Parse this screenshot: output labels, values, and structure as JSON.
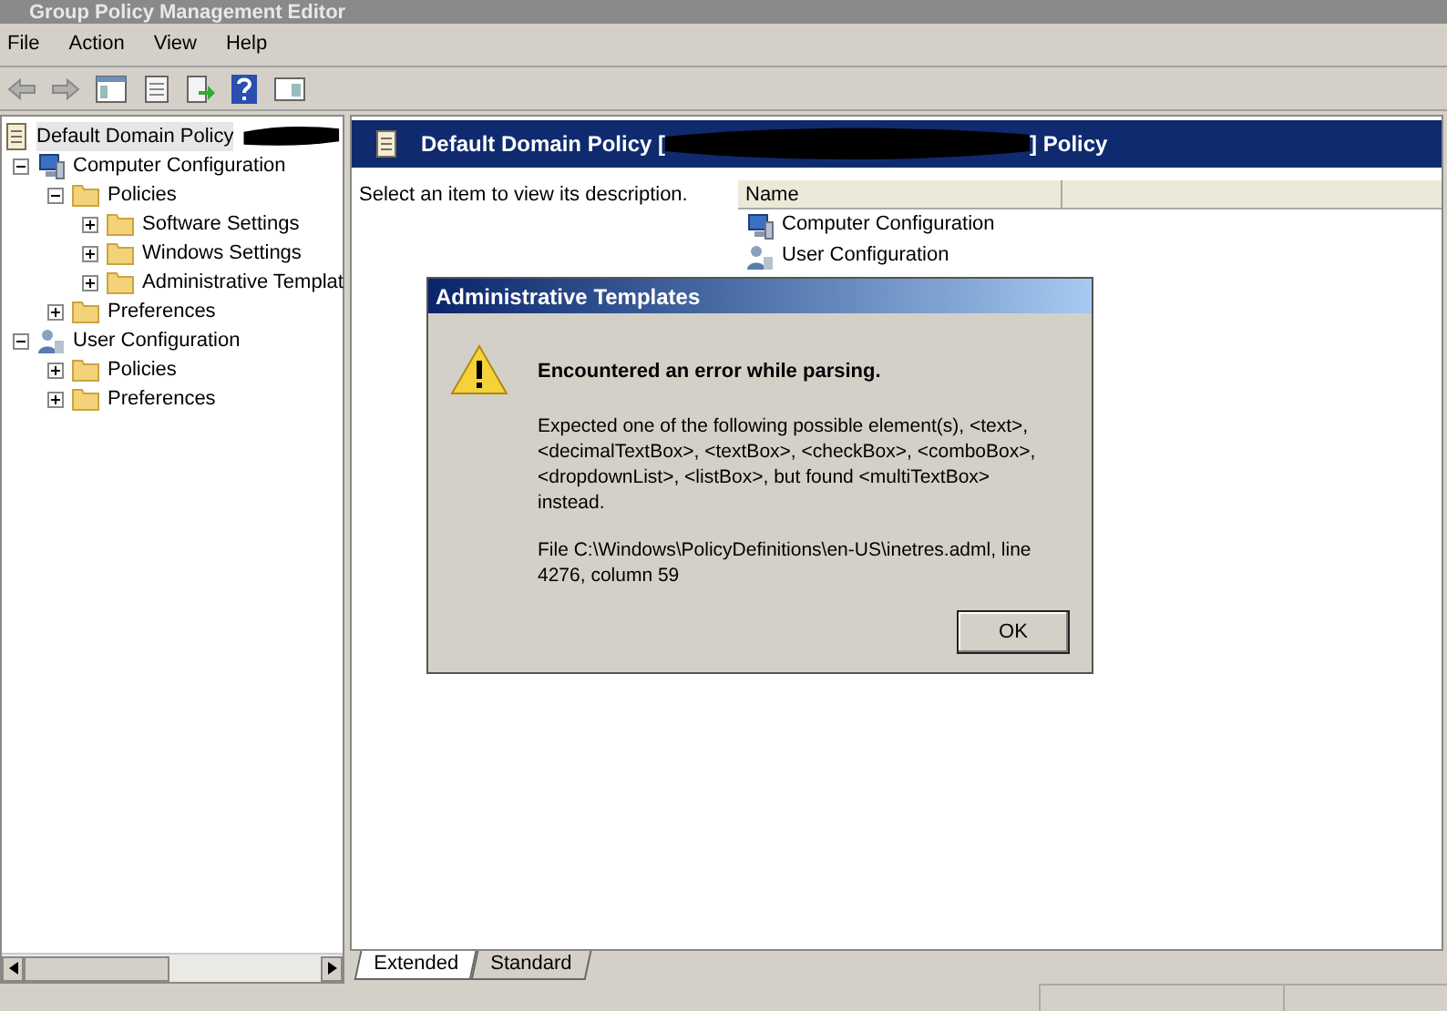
{
  "window": {
    "title": "Group Policy Management Editor"
  },
  "menu": [
    "File",
    "Action",
    "View",
    "Help"
  ],
  "tree": {
    "label": "Default Domain Policy",
    "kind": "policy",
    "selected": true,
    "children": [
      {
        "label": "Computer Configuration",
        "kind": "computer",
        "expanded": true,
        "children": [
          {
            "label": "Policies",
            "kind": "folder",
            "expanded": true,
            "children": [
              {
                "label": "Software Settings",
                "kind": "folder",
                "expanded": false
              },
              {
                "label": "Windows Settings",
                "kind": "folder",
                "expanded": false
              },
              {
                "label": "Administrative Templat",
                "kind": "folder",
                "expanded": false
              }
            ]
          },
          {
            "label": "Preferences",
            "kind": "folder",
            "expanded": false
          }
        ]
      },
      {
        "label": "User Configuration",
        "kind": "user",
        "expanded": true,
        "children": [
          {
            "label": "Policies",
            "kind": "folder",
            "expanded": false
          },
          {
            "label": "Preferences",
            "kind": "folder",
            "expanded": false
          }
        ]
      }
    ]
  },
  "header": {
    "title_start": "Default Domain Policy [",
    "title_end": "] Policy"
  },
  "description": "Select an item to view its description.",
  "list": {
    "columns": [
      "Name"
    ],
    "rows": [
      {
        "label": "Computer Configuration",
        "kind": "computer"
      },
      {
        "label": "User Configuration",
        "kind": "user"
      }
    ]
  },
  "tabs": [
    {
      "label": "Extended",
      "selected": true
    },
    {
      "label": "Standard",
      "selected": false
    }
  ],
  "dialog": {
    "title": "Administrative Templates",
    "heading": "Encountered an error while parsing.",
    "message": "Expected one of the following possible element(s), <text>, <decimalTextBox>, <textBox>, <checkBox>, <comboBox>, <dropdownList>, <listBox>, but found <multiTextBox> instead.",
    "detail": "File C:\\Windows\\PolicyDefinitions\\en-US\\inetres.adml, line 4276, column 59",
    "button": "OK"
  }
}
